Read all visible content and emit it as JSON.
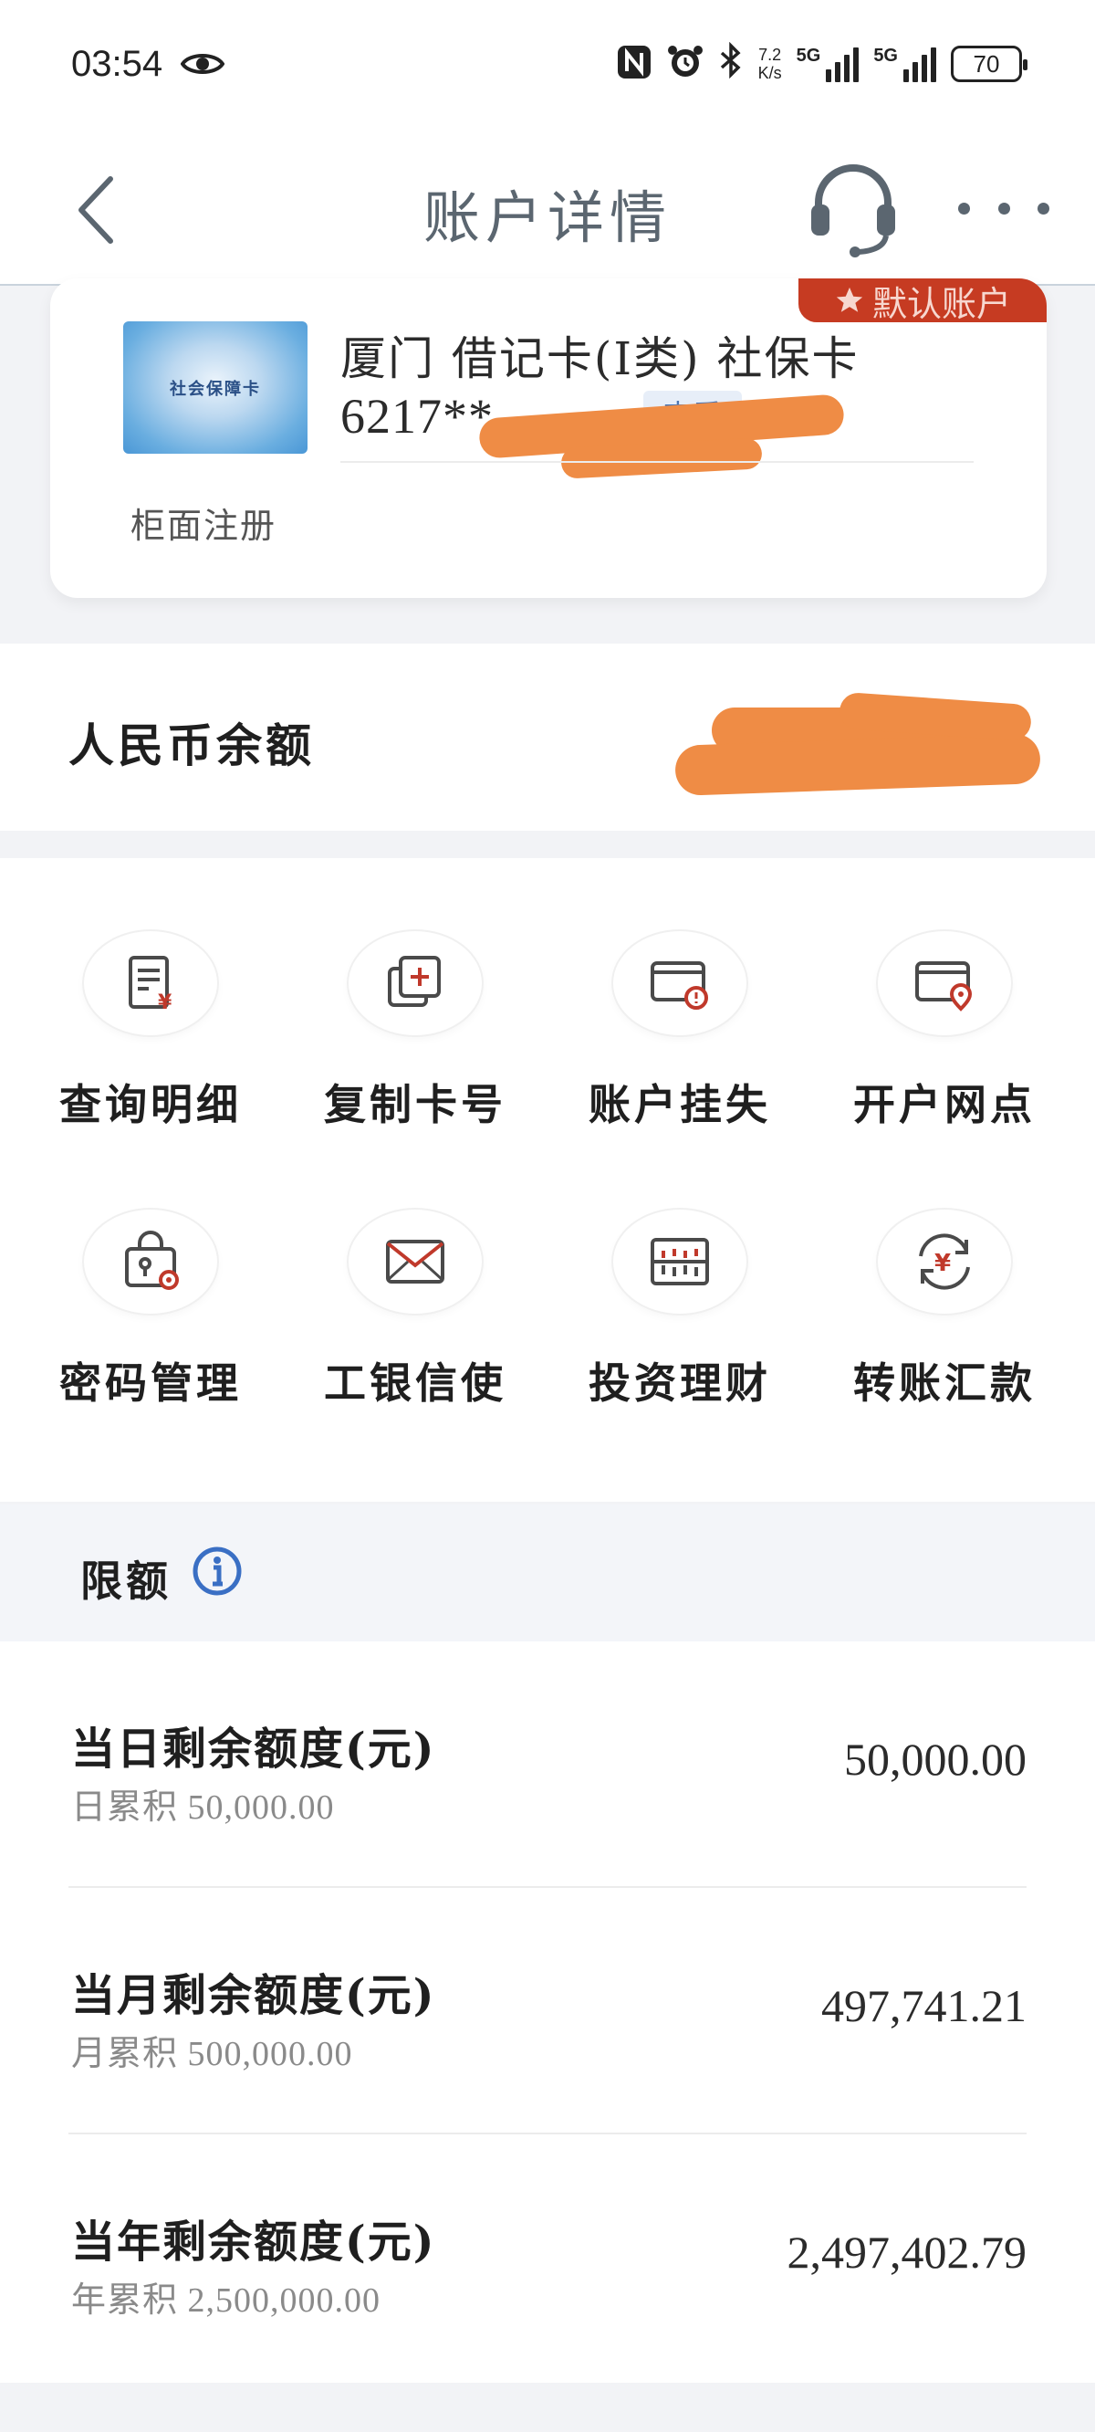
{
  "status_bar": {
    "time": "03:54",
    "speed_value": "7.2",
    "speed_unit": "K/s",
    "signal1": "5G",
    "signal2": "5G",
    "battery": "70"
  },
  "nav": {
    "title": "账户详情"
  },
  "card": {
    "default_tag": "默认账户",
    "image_text": "社会保障卡",
    "name": "厦门 借记卡(I类) 社保卡",
    "number": "6217**",
    "view_label": "查看",
    "registration": "柜面注册"
  },
  "balance": {
    "label": "人民币余额"
  },
  "functions": [
    {
      "label": "查询明细",
      "icon": "statement-yuan-icon"
    },
    {
      "label": "复制卡号",
      "icon": "copy-card-icon"
    },
    {
      "label": "账户挂失",
      "icon": "card-report-loss-icon"
    },
    {
      "label": "开户网点",
      "icon": "card-location-icon"
    },
    {
      "label": "密码管理",
      "icon": "lock-gear-icon"
    },
    {
      "label": "工银信使",
      "icon": "envelope-icon"
    },
    {
      "label": "投资理财",
      "icon": "abacus-icon"
    },
    {
      "label": "转账汇款",
      "icon": "transfer-yuan-icon"
    }
  ],
  "limits": {
    "title": "限额",
    "rows": [
      {
        "name": "当日剩余额度(元)",
        "accumulated": "日累积 50,000.00",
        "value": "50,000.00"
      },
      {
        "name": "当月剩余额度(元)",
        "accumulated": "月累积 500,000.00",
        "value": "497,741.21"
      },
      {
        "name": "当年剩余额度(元)",
        "accumulated": "年累积 2,500,000.00",
        "value": "2,497,402.79"
      }
    ]
  },
  "colors": {
    "accent_red": "#c63b22",
    "icon_red": "#c0392b",
    "info_blue": "#3a6fc4",
    "redaction": "#ef8c45"
  }
}
